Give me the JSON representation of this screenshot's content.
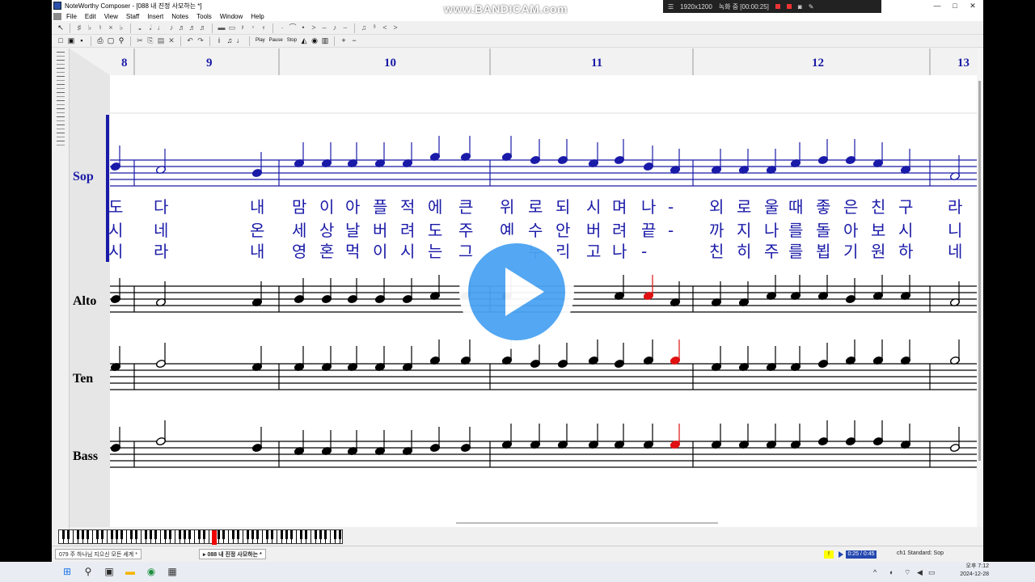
{
  "app": {
    "title": "NoteWorthy Composer - [088 내 진정 사모하는 *]",
    "menus": [
      "File",
      "Edit",
      "View",
      "Staff",
      "Insert",
      "Notes",
      "Tools",
      "Window",
      "Help"
    ],
    "window_controls": [
      "—",
      "□",
      "✕"
    ],
    "toolbar": {
      "play_label": "Play",
      "pause_label": "Pause",
      "stop_label": "Stop"
    }
  },
  "recorder": {
    "watermark": "www.BANDICAM.com",
    "resolution": "1920x1200",
    "status": "녹화 중 [00:00:25]"
  },
  "score": {
    "measure_numbers": [
      "8",
      "9",
      "10",
      "11",
      "12",
      "13"
    ],
    "staves": [
      {
        "name": "Sop",
        "color": "#1a1aa8"
      },
      {
        "name": "Alto",
        "color": "#000000"
      },
      {
        "name": "Ten",
        "color": "#000000"
      },
      {
        "name": "Bass",
        "color": "#000000"
      }
    ],
    "lyrics": [
      [
        "도",
        "다",
        "내",
        "맘",
        "이",
        "아",
        "플",
        "적",
        "에",
        "큰",
        "위",
        "로",
        "되",
        "시",
        "며",
        "나",
        "-",
        "외",
        "로",
        "울",
        "때",
        "좋",
        "은",
        "친",
        "구",
        "라"
      ],
      [
        "시",
        "네",
        "온",
        "세",
        "상",
        "날",
        "버",
        "려",
        "도",
        "주",
        "예",
        "수",
        "안",
        "버",
        "려",
        "끝",
        "-",
        "까",
        "지",
        "나",
        "를",
        "돌",
        "아",
        "보",
        "시",
        "니"
      ],
      [
        "시",
        "라",
        "내",
        "영",
        "혼",
        "먹",
        "이",
        "시",
        "는",
        "그",
        "",
        "누",
        "리",
        "고",
        "나",
        "-",
        "",
        "친",
        "히",
        "주",
        "를",
        "뵙",
        "기",
        "원",
        "하",
        "네"
      ]
    ],
    "highlight_color": "#e01010"
  },
  "status": {
    "tab1": "079 주 하나님 지으신 모든 세계 *",
    "tab2": "088 내 진정 사모하는 *",
    "badge": "!",
    "time": "0:25 / 0:45",
    "channel": "ch1 Standard: Sop"
  },
  "taskbar": {
    "clock_time": "오후 7:12",
    "clock_date": "2024-12-28"
  }
}
